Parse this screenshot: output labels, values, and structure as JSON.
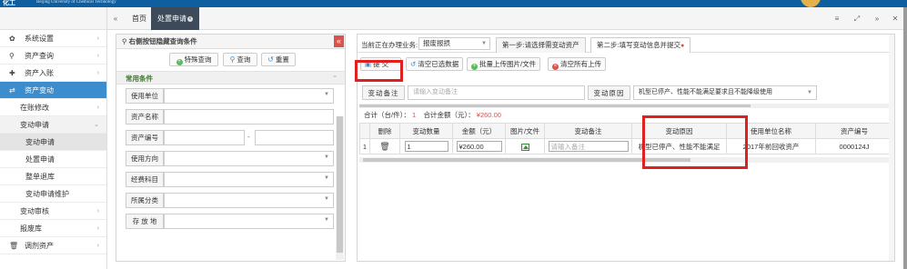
{
  "header": {
    "logo": "化工",
    "university": "Beijing University of Chemical Technology"
  },
  "tabbar": {
    "home": "首页",
    "active_tab": "处置申请",
    "close_glyph": "×"
  },
  "sidebar": {
    "items": [
      {
        "label": "系统设置",
        "icon": "gear-icon"
      },
      {
        "label": "资产查询",
        "icon": "search-icon"
      },
      {
        "label": "资产入账",
        "icon": "plus-icon"
      },
      {
        "label": "资产变动",
        "icon": "shuffle-icon",
        "active": true
      }
    ],
    "subitems": {
      "on_book": "在账修改",
      "change_apply": "变动申请",
      "leaf_change_apply": "变动申请",
      "leaf_dispose_apply": "处置申请",
      "leaf_whole_return": "整单退库",
      "leaf_apply_maint": "变动申请维护",
      "change_audit": "变动审核",
      "scrap_lib": "报废库",
      "transfer": "调剂资产"
    }
  },
  "query_panel": {
    "title": "右侧按钮隐藏查询条件",
    "collapse": "«",
    "buttons": {
      "special": "特殊查询",
      "query": "查询",
      "reset": "重置"
    },
    "section": "常用条件",
    "fields": {
      "unit": "使用单位",
      "name": "资产名称",
      "code": "资产编号",
      "dash": "-",
      "direction": "使用方向",
      "funding": "经费科目",
      "category": "所属分类",
      "location": "存 放 地"
    }
  },
  "main_panel": {
    "biz_label": "当前正在办理业务:",
    "biz_value": "报废报损",
    "step1": "第一步:请选择需变动资产",
    "step2": "第二步:填写变动信息并提交",
    "step2_dot": "●",
    "toolbar": {
      "submit": "提 交",
      "clear_selected": "清空已选数据",
      "batch_upload": "批量上传图片/文件",
      "clear_uploads": "清空所有上传"
    },
    "remarks": {
      "remark_label": "变动备注",
      "remark_placeholder": "请输入变动备注",
      "reason_label": "变动原因",
      "reason_value": "机型已停产、性能不能满足要求且不能降级使用"
    },
    "summary": {
      "count_label": "合计（台/件）：",
      "count_value": "1",
      "amount_label": "合计金额（元）：",
      "amount_value": "¥260.00"
    },
    "table": {
      "headers": [
        "",
        "删除",
        "变动数量",
        "金额（元）",
        "图片/文件",
        "变动备注",
        "变动原因",
        "使用单位名称",
        "资产编号"
      ],
      "rows": [
        {
          "index": "1",
          "qty": "1",
          "amount": "¥260.00",
          "remark_placeholder": "请输入备注",
          "reason": "机型已停产、性能不能满足",
          "unit_name": "2017年前回收资产",
          "code": "0000124J"
        }
      ]
    }
  },
  "colors": {
    "accent": "#3c8dce",
    "dark_tab": "#3c4a59",
    "highlight": "#e0201f",
    "danger": "#d9534f"
  }
}
